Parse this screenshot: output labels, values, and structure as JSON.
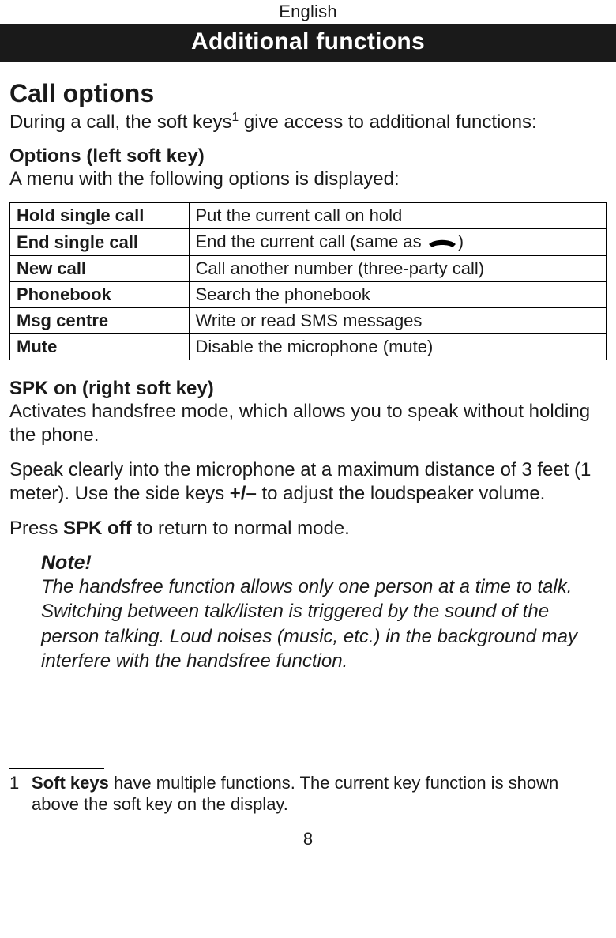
{
  "lang": "English",
  "banner": "Additional functions",
  "call_options": {
    "heading": "Call options",
    "intro_before": "During a call, the soft keys",
    "intro_sup": "1",
    "intro_after": " give access to additional functions:"
  },
  "options_left": {
    "heading": "Options (left soft key)",
    "desc": "A menu with the following options is displayed:"
  },
  "table": [
    {
      "k": "Hold single call",
      "v": "Put the current call on hold"
    },
    {
      "k": "End single call",
      "v_before": "End the current call (same as ",
      "v_after": ")"
    },
    {
      "k": "New call",
      "v": "Call another number (three-party call)"
    },
    {
      "k": "Phonebook",
      "v": "Search the phonebook"
    },
    {
      "k": "Msg centre",
      "v": "Write or read SMS messages"
    },
    {
      "k": "Mute",
      "v": "Disable the microphone (mute)"
    }
  ],
  "spk": {
    "heading": "SPK on (right soft key)",
    "p1": "Activates handsfree mode, which allows you to speak without holding the phone.",
    "p2_before": "Speak clearly into the microphone at a maximum distance of 3 feet (1 meter). Use the side keys ",
    "p2_bold": "+/–",
    "p2_after": " to adjust the loudspeaker volume.",
    "p3_before": "Press ",
    "p3_bold": "SPK off",
    "p3_after": " to return to normal mode."
  },
  "note": {
    "title": "Note!",
    "body": "The handsfree function allows only one person at a time to talk. Switching between talk/listen is triggered by the sound of the person talking. Loud noises (music, etc.) in the background may interfere with the handsfree function."
  },
  "footnote": {
    "num": "1",
    "bold": "Soft keys",
    "rest": " have multiple functions. The current key function is shown above the soft key on the display."
  },
  "page_number": "8"
}
